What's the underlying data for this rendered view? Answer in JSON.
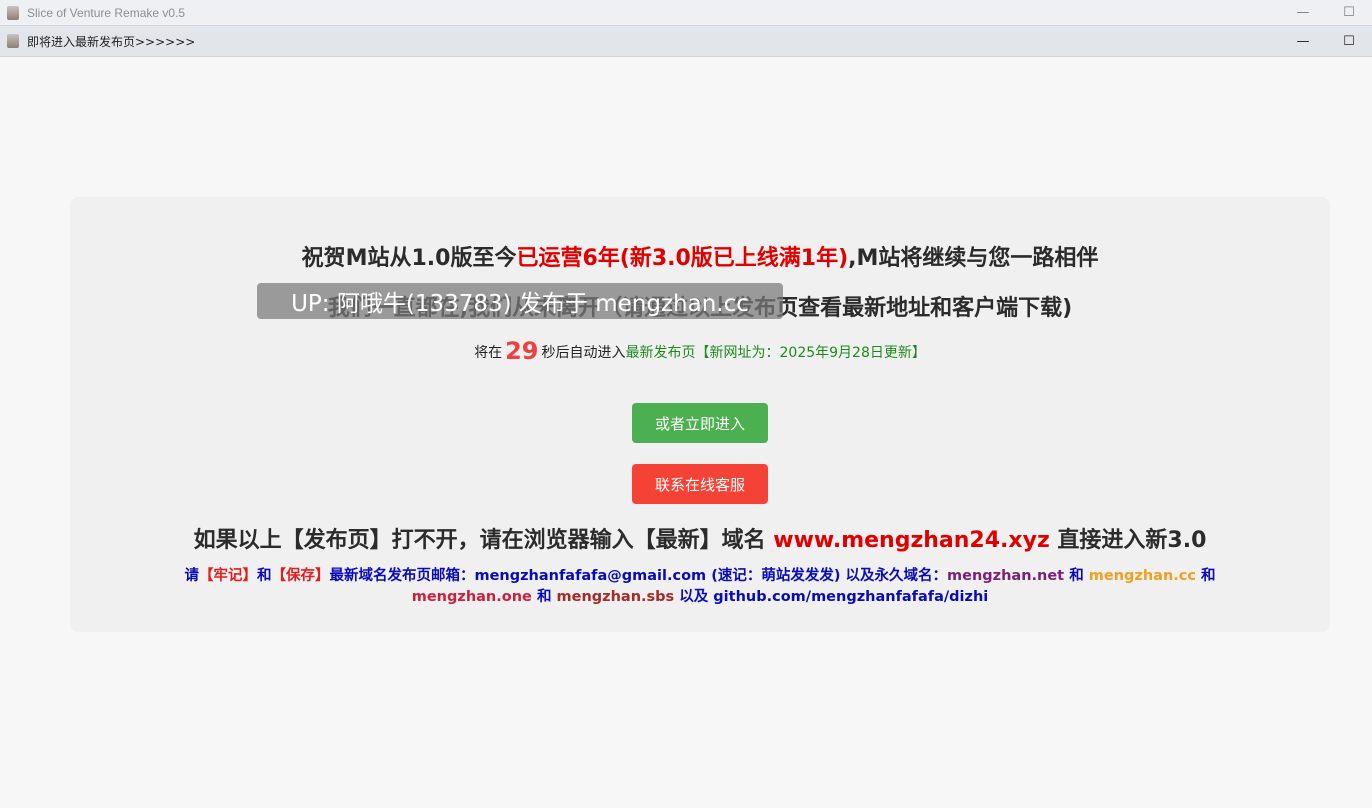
{
  "outer_window": {
    "title": "Slice of Venture Remake v0.5",
    "min_glyph": "—",
    "max_glyph": "☐"
  },
  "inner_window": {
    "title": "即将进入最新发布页>>>>>>",
    "min_glyph": "—",
    "max_glyph": "☐"
  },
  "notice": {
    "headline_1_a": "祝贺M站从1.0版至今",
    "headline_1_b": "已运营6年(新3.0版已上线满1年)",
    "headline_1_c": ",M站将继续与您一路相伴",
    "headline_2": "我们一直都在,我们从未离开（请通过以上发布页查看最新地址和客户端下载)",
    "countdown_prefix": "将在",
    "countdown_seconds": "29",
    "countdown_suffix": "秒后自动进入",
    "countdown_link": "最新发布页【新网址为：2025年9月28日更新】",
    "enter_button": "或者立即进入",
    "support_button": "联系在线客服",
    "fallback_a": "如果以上【发布页】打不开，请在浏览器输入【最新】域名",
    "fallback_domain": "www.mengzhan24.xyz",
    "fallback_b": "直接进入新3.0",
    "contact_1_a": "请",
    "contact_1_b": "【牢记】",
    "contact_1_c": "和",
    "contact_1_d": "【保存】",
    "contact_1_e": "最新域名发布页邮箱：mengzhanfafafa@gmail.com (速记：萌站发发发) 以及永久域名：",
    "contact_1_f": "mengzhan.net",
    "contact_1_g": "和",
    "contact_1_h": "mengzhan.cc",
    "contact_1_i": "和",
    "contact_2_a": "mengzhan.one",
    "contact_2_b": "和",
    "contact_2_c": "mengzhan.sbs",
    "contact_2_d": "以及 github.com/mengzhanfafafa/dizhi"
  },
  "watermark": {
    "text": "UP: 阿哦牛(133783) 发布于 mengzhan.cc"
  },
  "colors": {
    "accent_red": "#e00000",
    "button_green": "#4caf50",
    "button_red": "#f44336",
    "link_blue": "#0a0ab8"
  }
}
